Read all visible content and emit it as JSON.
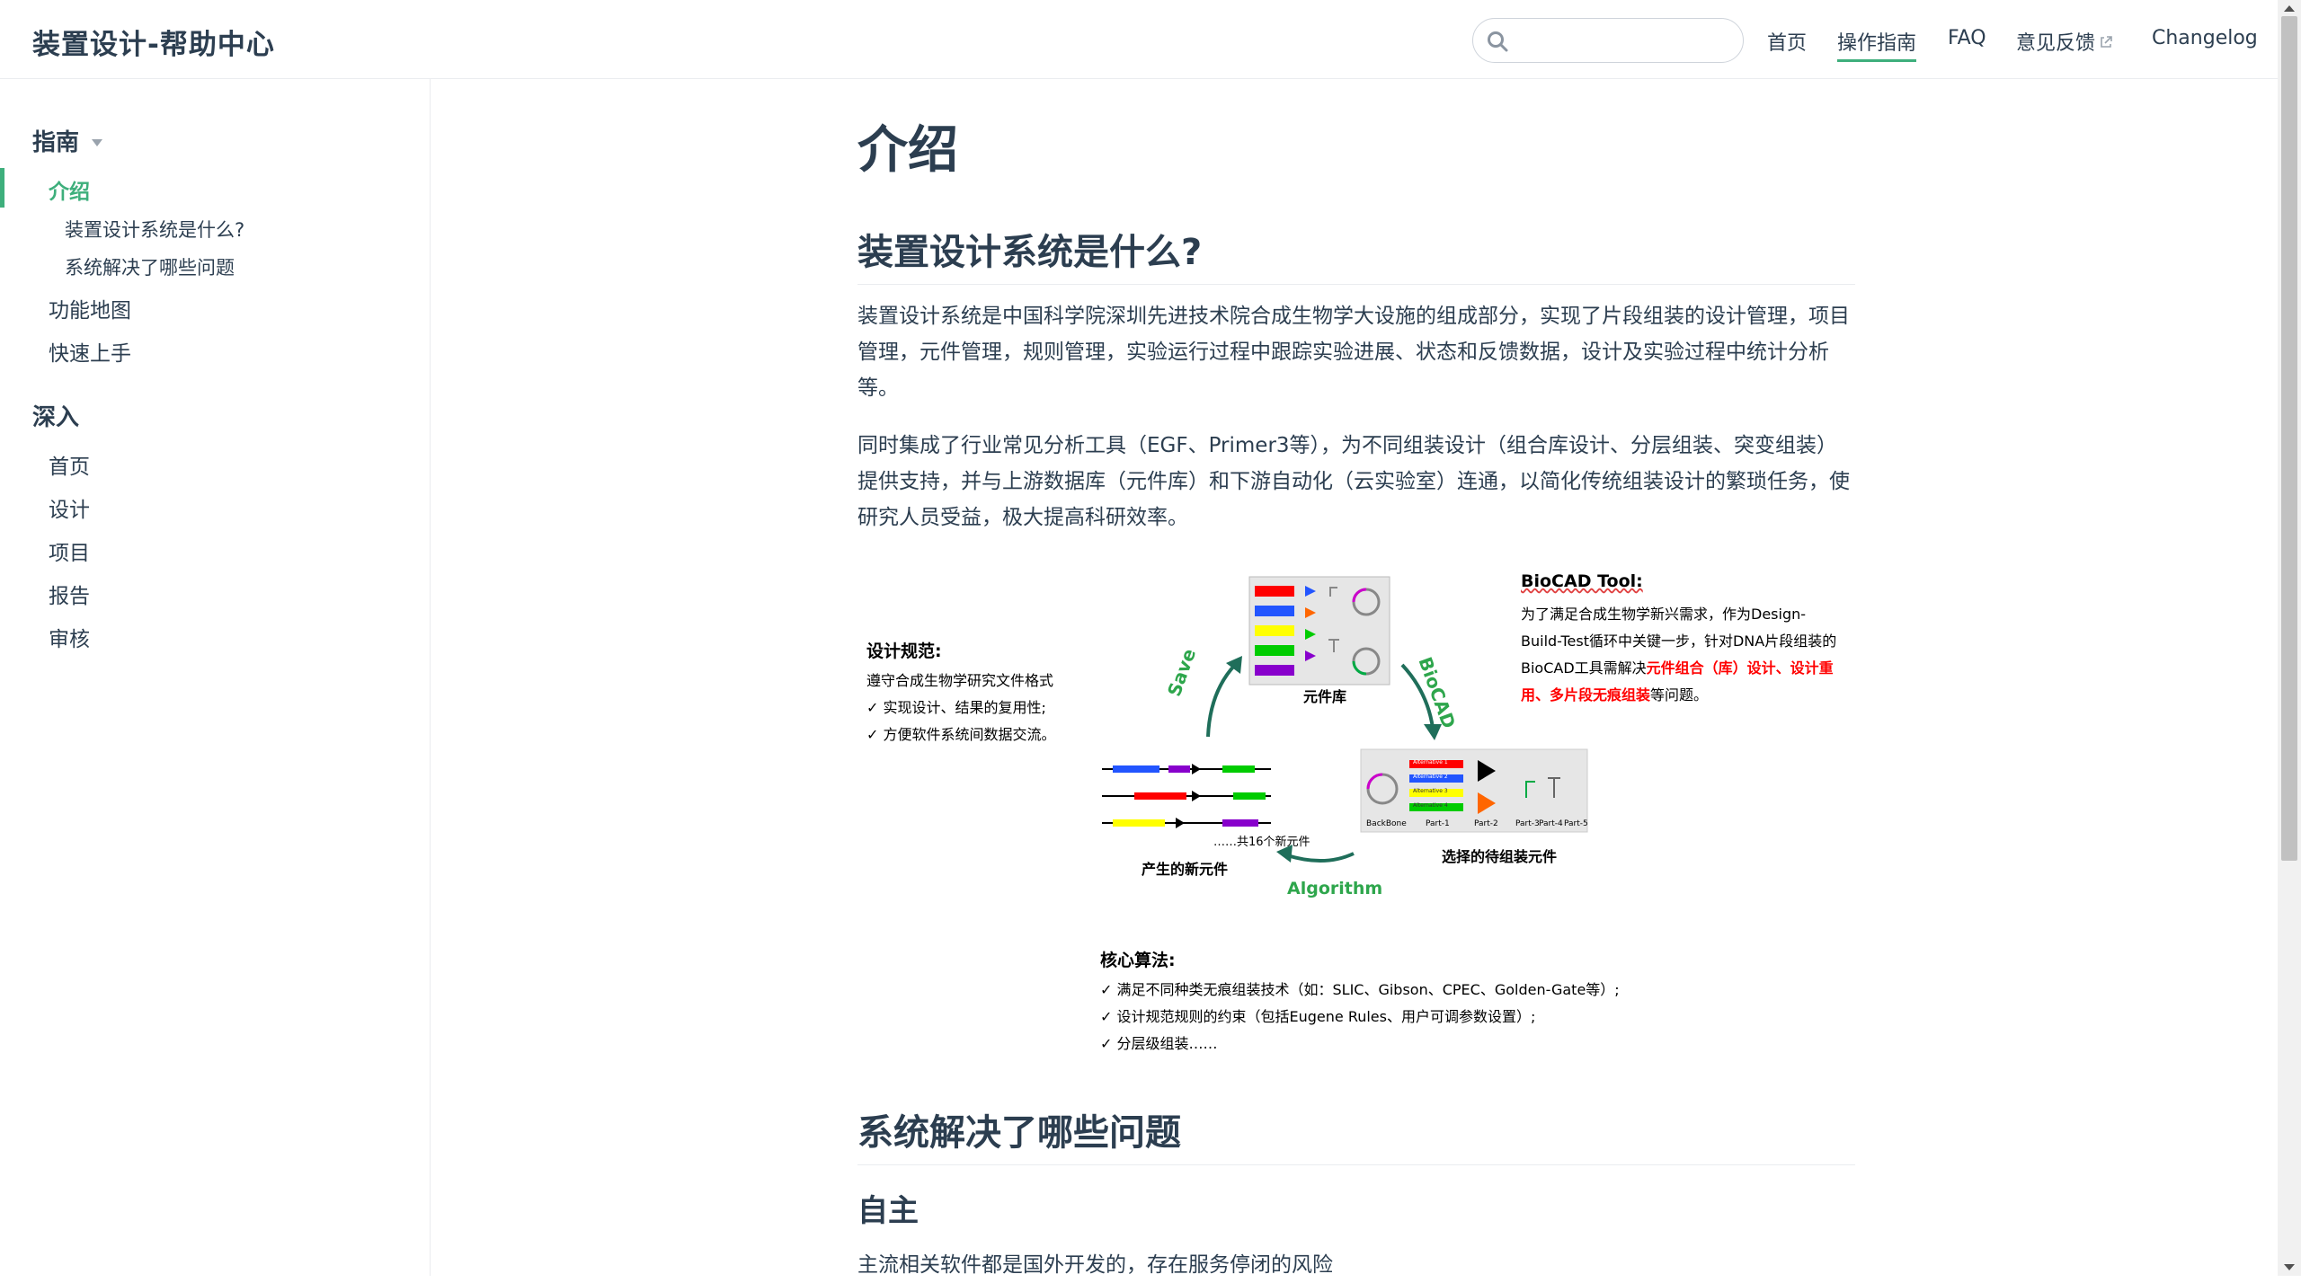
{
  "navbar": {
    "site_title": "装置设计-帮助中心",
    "search_placeholder": "",
    "links": [
      {
        "label": "首页"
      },
      {
        "label": "操作指南"
      },
      {
        "label": "FAQ"
      },
      {
        "label": "意见反馈"
      },
      {
        "label": "Changelog"
      }
    ]
  },
  "sidebar": {
    "guide": {
      "title": "指南",
      "items": [
        "介绍",
        "功能地图",
        "快速上手"
      ],
      "subitems": [
        "装置设计系统是什么?",
        "系统解决了哪些问题"
      ]
    },
    "deep": {
      "title": "深入",
      "items": [
        "首页",
        "设计",
        "项目",
        "报告",
        "审核"
      ]
    }
  },
  "content": {
    "title": "介绍",
    "section1": {
      "heading": "装置设计系统是什么?",
      "para1": "装置设计系统是中国科学院深圳先进技术院合成生物学大设施的组成部分，实现了片段组装的设计管理，项目管理，元件管理，规则管理，实验运行过程中跟踪实验进展、状态和反馈数据，设计及实验过程中统计分析等。",
      "para2": "同时集成了行业常见分析工具（EGF、Primer3等），为不同组装设计（组合库设计、分层组装、突变组装）提供支持，并与上游数据库（元件库）和下游自动化（云实验室）连通，以简化传统组装设计的繁琐任务，使研究人员受益，极大提高科研效率。"
    },
    "figure": {
      "design_title": "设计规范:",
      "design_line1": "遵守合成生物学研究文件格式",
      "design_check1": "实现设计、结果的复用性;",
      "design_check2": "方便软件系统间数据交流。",
      "biocad_title": "BioCAD Tool:",
      "biocad_line1": "为了满足合成生物学新兴需求，作为Design-",
      "biocad_line2": "Build-Test循环中关键一步，针对DNA片段组装的",
      "biocad_line3a": "BioCAD工具需解决",
      "biocad_line3b": "元件组合（库）设计、设计重",
      "biocad_line4a": "用、多片段无痕组装",
      "biocad_line4b": "等问题。",
      "library_label": "元件库",
      "save_label": "Save",
      "biocad_arrow_label": "BioCAD",
      "algorithm_label": "Algorithm",
      "new_parts_label": "产生的新元件",
      "total_label": "……共16个新元件",
      "pending_label": "选择的待组装元件",
      "backbone": "BackBone",
      "parts": [
        "Part-1",
        "Part-2",
        "Part-3",
        "Part-4",
        "Part-5"
      ],
      "alternatives": [
        "Alternative 1",
        "Alternative 2",
        "Alternative 3",
        "Alternative 4"
      ],
      "core_title": "核心算法:",
      "core_check1": "满足不同种类无痕组装技术（如：SLIC、Gibson、CPEC、Golden-Gate等）;",
      "core_check2": "设计规范规则的约束（包括Eugene Rules、用户可调参数设置）;",
      "core_check3": "分层级组装……"
    },
    "section2": {
      "heading": "系统解决了哪些问题",
      "sub1": "自主",
      "sub1_text": "主流相关软件都是国外开发的，存在服务停闭的风险"
    }
  },
  "colors": {
    "accent": "#3eaf7c",
    "text": "#2c3e50",
    "border": "#eaecef"
  }
}
